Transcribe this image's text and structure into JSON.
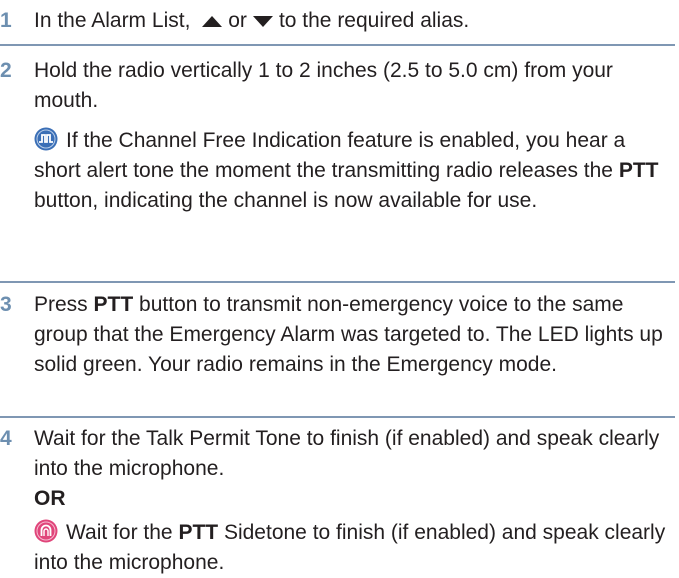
{
  "steps": [
    {
      "number": "1",
      "text_before": "In the Alarm List,",
      "text_or": "or",
      "text_after": "to the required alias.",
      "icons": [
        "arrow-up-icon",
        "arrow-down-icon"
      ]
    },
    {
      "number": "2",
      "text": "Hold the radio vertically 1 to 2 inches (2.5 to 5.0 cm) from your mouth.",
      "note_icon": "channel-free-indication-icon",
      "note_before": "If the Channel Free Indication feature is enabled, you hear a short alert tone the moment the transmitting radio releases the",
      "note_bold": "PTT",
      "note_after": "button, indicating the channel is now available for use."
    },
    {
      "number": "3",
      "text_before": "Press",
      "text_bold": "PTT",
      "text_after": "button to transmit non-emergency voice to the same group that the Emergency Alarm was targeted to. The LED lights up solid green. Your radio remains in the Emergency mode."
    },
    {
      "number": "4",
      "text": "Wait for the Talk Permit Tone to finish (if enabled) and speak clearly into the microphone.",
      "or_label": "OR",
      "alt_icon": "ptt-sidetone-icon",
      "alt_before": "Wait for the",
      "alt_bold": "PTT",
      "alt_after": "Sidetone to finish (if enabled) and speak clearly into the microphone."
    }
  ],
  "colors": {
    "step_number": "#6d8fb0",
    "rule": "#7f97b3",
    "text": "#231f20",
    "channel_icon": "#3b6fb6",
    "sidetone_icon": "#e0457a"
  }
}
